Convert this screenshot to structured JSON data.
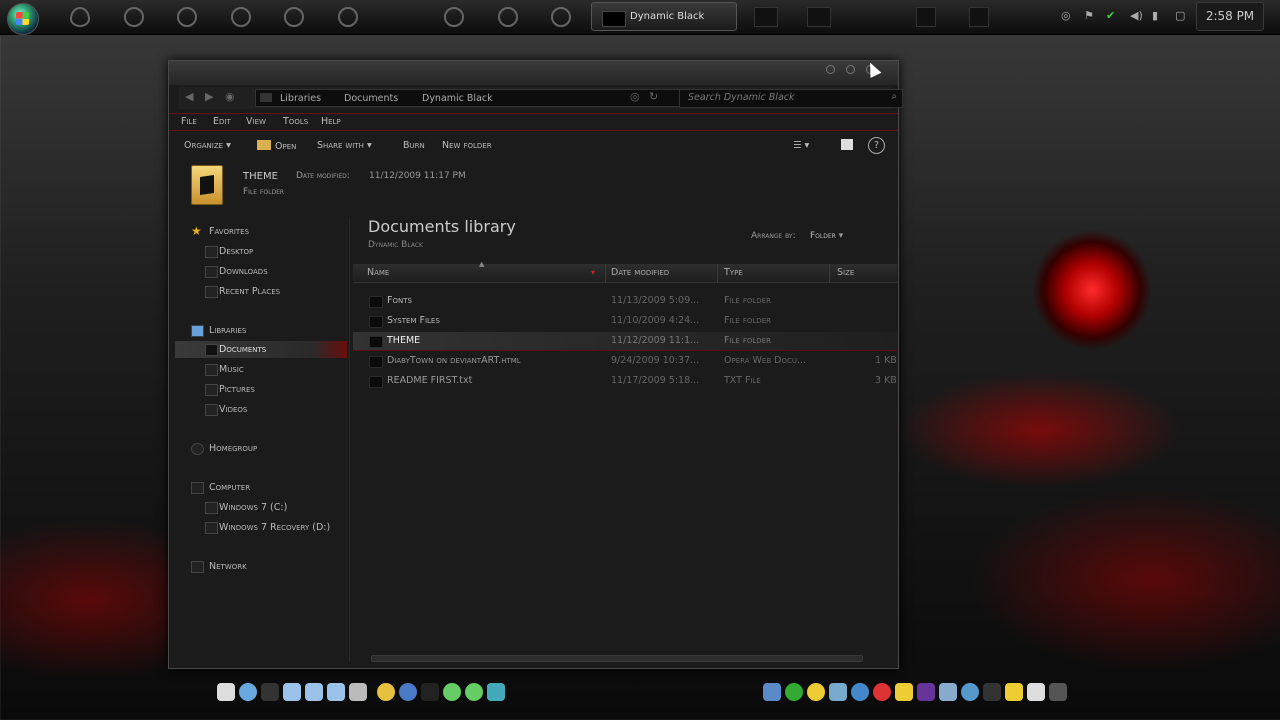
{
  "taskbar": {
    "active_task": "Dynamic Black",
    "clock": "2:58 PM",
    "icons": [
      "start-orb",
      "opera-icon",
      "firefox-icon",
      "chrome-icon",
      "thunderbird-icon",
      "compass-icon",
      "globe-icon",
      "media-icon",
      "play-icon",
      "itunes-icon",
      "cmd-icon",
      "window-icon",
      "text-icon",
      "checkbox-icon"
    ]
  },
  "address": {
    "back": "◀",
    "forward": "▶",
    "crumbs": [
      "Libraries",
      "Documents",
      "Dynamic Black"
    ],
    "search_placeholder": "Search Dynamic Black"
  },
  "menu": [
    "File",
    "Edit",
    "View",
    "Tools",
    "Help"
  ],
  "commands": {
    "organize": "Organize",
    "open": "Open",
    "share_with": "Share with",
    "burn": "Burn",
    "new_folder": "New folder",
    "help": "?"
  },
  "details": {
    "name": "THEME",
    "date_modified_label": "Date modified:",
    "date_modified": "11/12/2009 11:17 PM",
    "type": "File folder"
  },
  "nav": {
    "favorites": "Favorites",
    "desktop": "Desktop",
    "downloads": "Downloads",
    "recent": "Recent Places",
    "libraries": "Libraries",
    "documents": "Documents",
    "music": "Music",
    "pictures": "Pictures",
    "videos": "Videos",
    "homegroup": "Homegroup",
    "computer": "Computer",
    "drive_c": "Windows 7 (C:)",
    "drive_d": "Windows 7 Recovery (D:)",
    "network": "Network"
  },
  "library": {
    "title": "Documents library",
    "subtitle": "Dynamic Black",
    "arrange_by_label": "Arrange by:",
    "arrange_by_value": "Folder"
  },
  "columns": {
    "name": "Name",
    "date": "Date modified",
    "type": "Type",
    "size": "Size"
  },
  "files": [
    {
      "name": "Fonts",
      "date": "11/13/2009 5:09...",
      "type": "File folder",
      "size": ""
    },
    {
      "name": "System Files",
      "date": "11/10/2009 4:24...",
      "type": "File folder",
      "size": ""
    },
    {
      "name": "THEME",
      "date": "11/12/2009 11:1...",
      "type": "File folder",
      "size": ""
    },
    {
      "name": "DiabyTown on deviantART.html",
      "date": "9/24/2009 10:37...",
      "type": "Opera Web Docu...",
      "size": "1 KB"
    },
    {
      "name": "README FIRST.txt",
      "date": "11/17/2009 5:18...",
      "type": "TXT File",
      "size": "3 KB"
    }
  ],
  "colors": {
    "accent": "#6a1010",
    "window_bg": "#1b1b1b",
    "text": "#bbbbbb"
  }
}
